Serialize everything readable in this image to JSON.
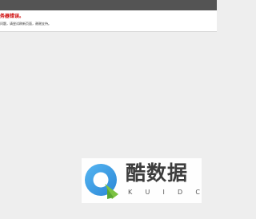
{
  "error": {
    "title": "务器错误。",
    "message": "问题，请尝试刷新页面，谢谢支持。"
  },
  "watermark": {
    "brand": "酷数据",
    "letters": [
      "K",
      "U",
      "I",
      "D",
      "C"
    ]
  },
  "colors": {
    "top_bar": "#545454",
    "error_red": "#cc0000",
    "background": "#eeeeee",
    "logo_blue": "#3aa0e8",
    "logo_green": "#7cc242"
  }
}
